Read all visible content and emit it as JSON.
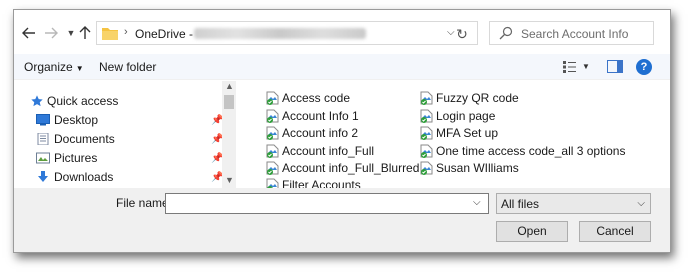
{
  "address_bar": {
    "path_root": "OneDrive - ",
    "search_placeholder": "Search Account Info"
  },
  "icons": {
    "back": "arrow-left-icon",
    "forward": "arrow-right-icon",
    "recent": "chevron-down-icon",
    "up": "arrow-up-icon",
    "refresh": "refresh-icon",
    "search": "search-icon",
    "help": "help-icon"
  },
  "toolbar": {
    "organize": "Organize",
    "new_folder": "New folder"
  },
  "nav": {
    "items": [
      {
        "label": "Quick access",
        "icon": "star-icon",
        "pinned": false
      },
      {
        "label": "Desktop",
        "icon": "desktop-icon",
        "pinned": true
      },
      {
        "label": "Documents",
        "icon": "documents-icon",
        "pinned": true
      },
      {
        "label": "Pictures",
        "icon": "pictures-icon",
        "pinned": true
      },
      {
        "label": "Downloads",
        "icon": "downloads-icon",
        "pinned": true
      }
    ]
  },
  "files": {
    "column1": [
      "Access code",
      "Account Info 1",
      "Account info 2",
      "Account info_Full",
      "Account info_Full_Blurred",
      "Filter Accounts"
    ],
    "column2": [
      "Fuzzy QR code",
      "Login page",
      "MFA Set up",
      "One time access code_all 3 options",
      "Susan WIlliams"
    ]
  },
  "bottom": {
    "file_name_label": "File name:",
    "file_name_value": "",
    "file_type": "All files",
    "open_label": "Open",
    "cancel_label": "Cancel"
  },
  "colors": {
    "accent": "#1f6fd1",
    "folder": "#f5c342",
    "sync_check": "#2e9e3a"
  }
}
